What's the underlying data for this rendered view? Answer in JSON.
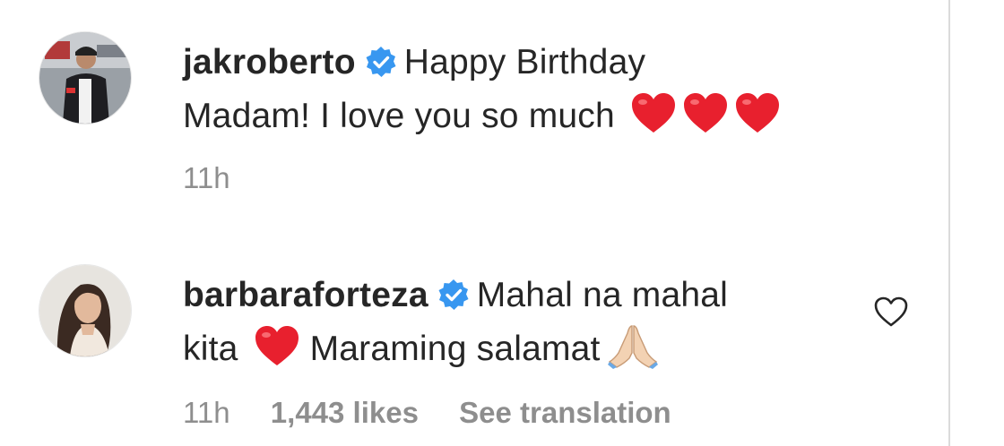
{
  "comments": [
    {
      "username": "jakroberto",
      "text_line1": "Happy Birthday",
      "text_line2": "Madam! I love you so much",
      "time": "11h",
      "emoji": [
        "red-heart",
        "red-heart",
        "red-heart"
      ]
    },
    {
      "username": "barbaraforteza",
      "text_line1": "Mahal na mahal",
      "text_line2a": "kita",
      "text_line2b": "Maraming salamat",
      "time": "11h",
      "likes": "1,443 likes",
      "translation": "See translation",
      "emoji": [
        "red-heart",
        "folded-hands"
      ]
    }
  ],
  "icons": {
    "verified": "verified-badge-icon",
    "like": "heart-outline-icon"
  },
  "colors": {
    "text": "#262626",
    "meta": "#8e8e8e",
    "verified_blue": "#3897f0",
    "heart_red": "#e8202e",
    "divider": "#dbdbdb"
  }
}
